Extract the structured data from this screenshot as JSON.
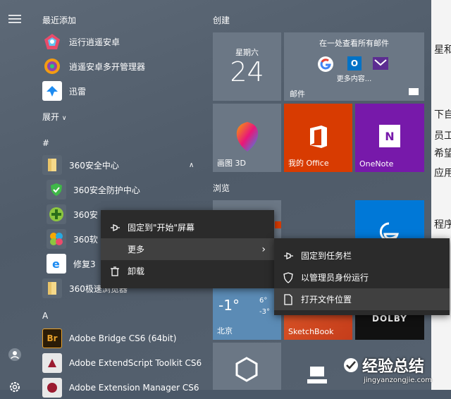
{
  "recent": {
    "header": "最近添加",
    "apps": [
      {
        "label": "运行逍遥安卓"
      },
      {
        "label": "逍遥安卓多开管理器"
      },
      {
        "label": "迅雷"
      }
    ],
    "expand_label": "展开"
  },
  "group_hash": {
    "header": "#",
    "folder_360": {
      "label": "360安全中心"
    },
    "items": [
      {
        "label": "360安全防护中心"
      },
      {
        "label": "360安"
      },
      {
        "label": "360软"
      },
      {
        "label": "修复3"
      }
    ],
    "folder_browser": {
      "label": "360极速浏览器"
    }
  },
  "group_a": {
    "header": "A",
    "apps": [
      {
        "label": "Adobe Bridge CS6 (64bit)",
        "icon_text": "Br"
      },
      {
        "label": "Adobe ExtendScript Toolkit CS6"
      },
      {
        "label": "Adobe Extension Manager CS6"
      }
    ]
  },
  "tiles": {
    "create_header": "创建",
    "browse_header": "浏览",
    "calendar": {
      "weekday": "星期六",
      "day": "24"
    },
    "mail_wide": {
      "title": "在一处查看所有邮件",
      "more": "更多内容...",
      "name": "邮件"
    },
    "paint3d": {
      "label": "画图 3D"
    },
    "office": {
      "label": "我的 Office"
    },
    "onenote": {
      "label": "OneNote"
    },
    "weather": {
      "temp_now": "-1°",
      "temp_hi": "6°",
      "temp_lo": "-3°",
      "city": "北京"
    },
    "sketchbook": {
      "label": "SketchBook"
    },
    "dolby": {
      "label": "DOLBY"
    }
  },
  "context_menu": {
    "items": [
      {
        "label": "固定到\"开始\"屏幕"
      },
      {
        "label": "更多"
      },
      {
        "label": "卸载"
      }
    ]
  },
  "submenu": {
    "items": [
      {
        "label": "固定到任务栏"
      },
      {
        "label": "以管理员身份运行"
      },
      {
        "label": "打开文件位置"
      }
    ]
  },
  "background_doc": {
    "fragments": [
      "星和",
      "下自",
      "员工",
      "希望",
      "应用",
      "程序"
    ]
  },
  "watermark": {
    "title": "经验总结",
    "url": "jingyanzongjie.com"
  },
  "colors": {
    "office": "#d83b01",
    "onenote": "#7719aa",
    "edge": "#0078d7",
    "menu": "#2b2b2b"
  }
}
